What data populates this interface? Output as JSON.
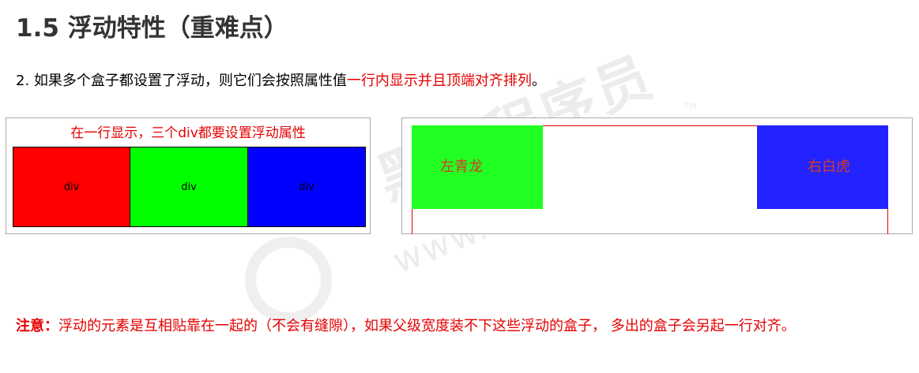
{
  "title": "1.5 浮动特性（重难点）",
  "point": {
    "prefix": "2. 如果多个盒子都设置了浮动，则它们会按照属性值",
    "highlight": "一行内显示并且顶端对齐排列",
    "suffix": "。"
  },
  "demo1": {
    "caption": "在一行显示，三个div都要设置浮动属性",
    "boxes": [
      {
        "label": "div",
        "color": "#ff0000"
      },
      {
        "label": "div",
        "color": "#00ff00"
      },
      {
        "label": "div",
        "color": "#0000ff"
      }
    ]
  },
  "demo2": {
    "left_label": "左青龙",
    "right_label": "右白虎",
    "left_color": "#22ff22",
    "right_color": "#2323ff",
    "parent_border_color": "#e60000"
  },
  "note": {
    "label": "注意：",
    "text": "浮动的元素是互相贴靠在一起的（不会有缝隙），如果父级宽度装不下这些浮动的盒子， 多出的盒子会另起一行对齐。"
  },
  "watermark": {
    "brand": "黑马程序员",
    "url": "www.itheima.com",
    "tm": "TM",
    "icon": "itheima-logo-icon"
  },
  "colors": {
    "title": "#333333",
    "highlight": "#e60000",
    "note": "#e60000"
  }
}
